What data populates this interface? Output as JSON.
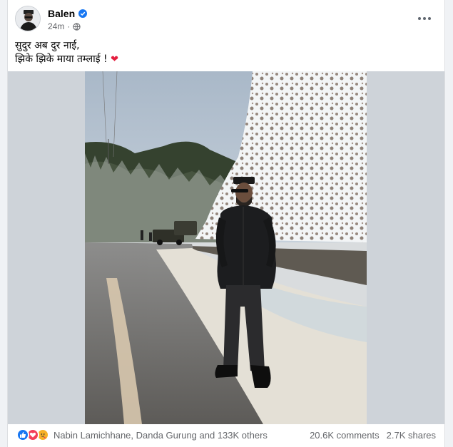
{
  "post": {
    "author": "Balen",
    "time": "24m",
    "text_line1": "सुदुर अब दुर नाई,",
    "text_line2": "झिके झिके माया तम्लाई !",
    "reactions_text": "Nabin Lamichhane, Danda Gurung and 133K others",
    "comments": "20.6K comments",
    "shares": "2.7K shares"
  },
  "icons": {
    "verified": "verified-badge-icon",
    "audience": "globe-icon",
    "more": "more-options-icon",
    "reactions": [
      "like-icon",
      "love-icon",
      "care-icon"
    ]
  },
  "colors": {
    "accent": "#1877f2",
    "love": "#f33e58",
    "care": "#f7b125",
    "secondary_text": "#65676b"
  }
}
